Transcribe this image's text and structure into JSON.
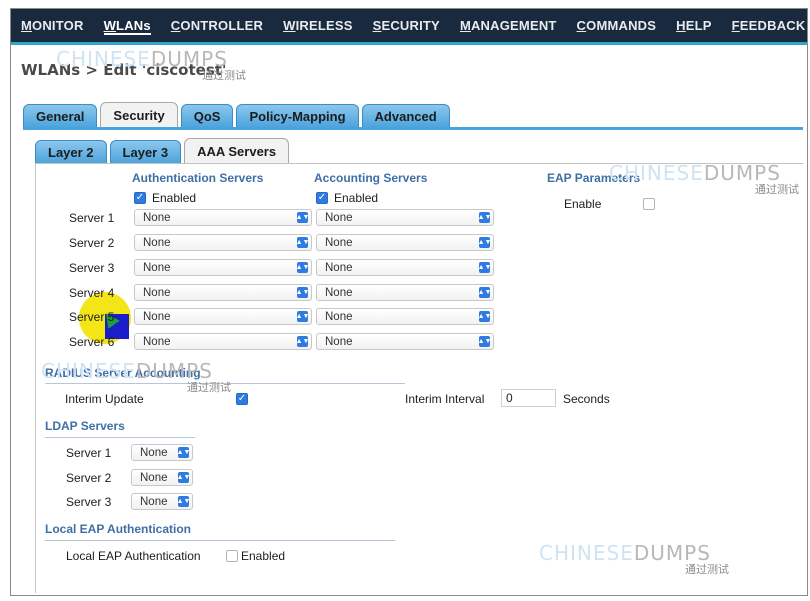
{
  "nav": {
    "items": [
      {
        "label": "MONITOR",
        "ul": "M",
        "rest": "ONITOR"
      },
      {
        "label": "WLANs",
        "ul": "W",
        "rest": "LANs"
      },
      {
        "label": "CONTROLLER",
        "ul": "C",
        "rest": "ONTROLLER"
      },
      {
        "label": "WIRELESS",
        "ul": "W",
        "rest": "IRELESS"
      },
      {
        "label": "SECURITY",
        "ul": "S",
        "rest": "ECURITY"
      },
      {
        "label": "MANAGEMENT",
        "ul": "M",
        "rest": "ANAGEMENT"
      },
      {
        "label": "COMMANDS",
        "ul": "C",
        "rest": "OMMANDS"
      },
      {
        "label": "HELP",
        "ul": "H",
        "rest": "ELP"
      },
      {
        "label": "FEEDBACK",
        "ul": "F",
        "rest": "EEDBACK"
      }
    ],
    "active": "WLANs"
  },
  "breadcrumb": "WLANs > Edit  'ciscotest'",
  "outer_tabs": [
    "General",
    "Security",
    "QoS",
    "Policy-Mapping",
    "Advanced"
  ],
  "outer_active": "Security",
  "inner_tabs": [
    "Layer 2",
    "Layer 3",
    "AAA Servers"
  ],
  "inner_active": "AAA Servers",
  "auth": {
    "heading": "Authentication Servers",
    "enabled_label": "Enabled",
    "enabled": true
  },
  "acct": {
    "heading": "Accounting Servers",
    "enabled_label": "Enabled",
    "enabled": true
  },
  "eap": {
    "heading": "EAP Parameters",
    "enable_label": "Enable",
    "enabled": false
  },
  "servers": [
    {
      "label": "Server 1",
      "auth": "None",
      "acct": "None"
    },
    {
      "label": "Server 2",
      "auth": "None",
      "acct": "None"
    },
    {
      "label": "Server 3",
      "auth": "None",
      "acct": "None"
    },
    {
      "label": "Server 4",
      "auth": "None",
      "acct": "None"
    },
    {
      "label": "Server 5",
      "auth": "None",
      "acct": "None"
    },
    {
      "label": "Server 6",
      "auth": "None",
      "acct": "None"
    }
  ],
  "radius": {
    "heading": "RADIUS Server Accounting",
    "interim_update_label": "Interim Update",
    "interim_update": true,
    "interim_interval_label": "Interim Interval",
    "interim_interval_value": "0",
    "seconds_label": "Seconds"
  },
  "ldap": {
    "heading": "LDAP Servers",
    "servers": [
      {
        "label": "Server 1",
        "value": "None"
      },
      {
        "label": "Server 2",
        "value": "None"
      },
      {
        "label": "Server 3",
        "value": "None"
      }
    ]
  },
  "local_eap": {
    "heading": "Local EAP Authentication",
    "label": "Local EAP Authentication",
    "enabled_label": "Enabled",
    "enabled": false
  },
  "watermark": {
    "part_a": "CHINESE",
    "part_b": "DUMPS",
    "sub": "通过测试"
  },
  "colors": {
    "nav_bg": "#1a2a3e",
    "tab_blue": "#4aa3dd",
    "section_blue": "#3f6fa5",
    "check_blue": "#2f7ce0"
  }
}
